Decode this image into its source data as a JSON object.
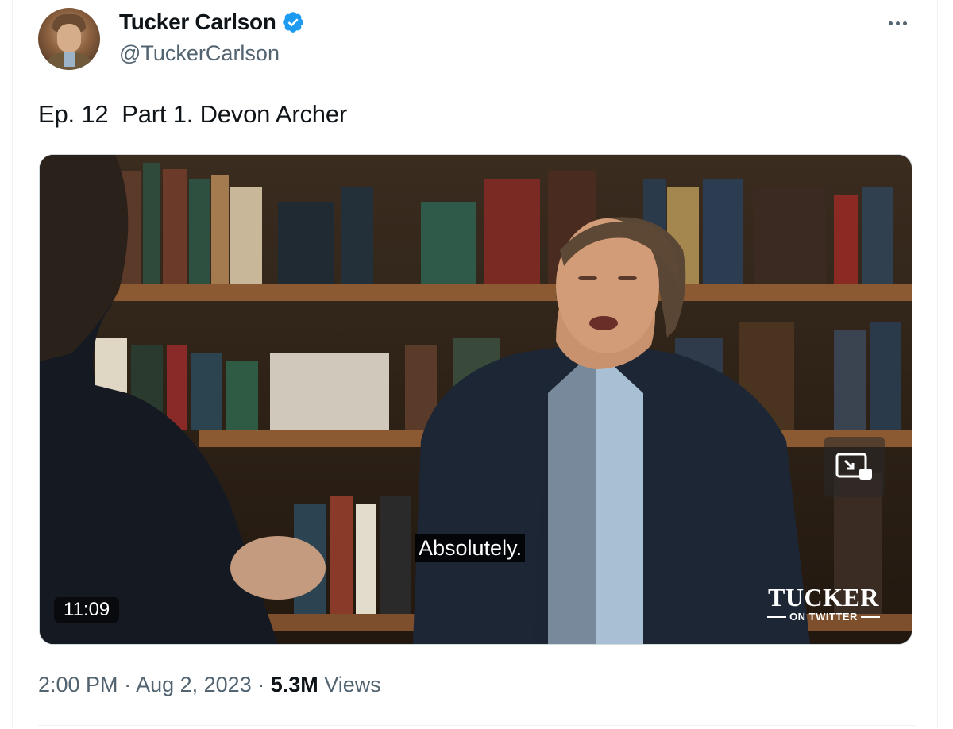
{
  "author": {
    "display_name": "Tucker Carlson",
    "handle": "@TuckerCarlson",
    "verified": true,
    "verified_icon": "verified-badge-icon",
    "verified_color": "#1d9bf0"
  },
  "tweet": {
    "text": "Ep. 12  Part 1. Devon Archer"
  },
  "media": {
    "type": "video",
    "duration": "11:09",
    "subtitle": "Absolutely.",
    "logo_line1": "TUCKER",
    "logo_line2": "ON TWITTER",
    "pip_icon": "picture-in-picture-icon"
  },
  "meta": {
    "time": "2:00 PM",
    "separator": " · ",
    "date": "Aug 2, 2023",
    "views_count": "5.3M",
    "views_label": " Views"
  },
  "colors": {
    "text_primary": "#0f1419",
    "text_secondary": "#536471",
    "border": "#cfd9de"
  }
}
